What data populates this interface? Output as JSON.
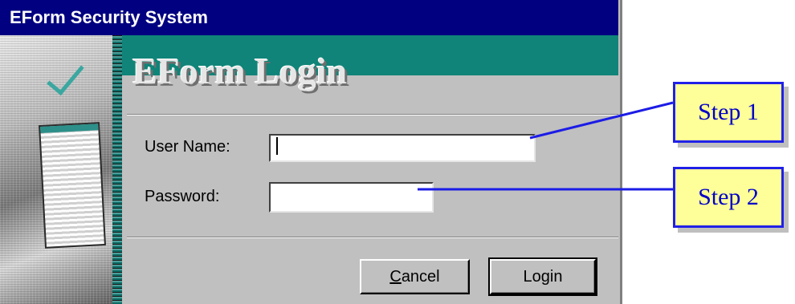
{
  "window": {
    "title": "EForm Security System"
  },
  "header": {
    "heading": "EForm Login"
  },
  "form": {
    "username": {
      "label": "User Name:",
      "value": ""
    },
    "password": {
      "label": "Password:",
      "value": ""
    }
  },
  "buttons": {
    "cancel": {
      "accel": "C",
      "rest": "ancel"
    },
    "login": {
      "label": "Login"
    }
  },
  "callouts": {
    "step1": "Step 1",
    "step2": "Step 2"
  },
  "colors": {
    "titlebar": "#000080",
    "header_band": "#108478",
    "dialog": "#c0c0c0",
    "callout_fill": "#ffff99",
    "callout_border": "#2020e8"
  }
}
